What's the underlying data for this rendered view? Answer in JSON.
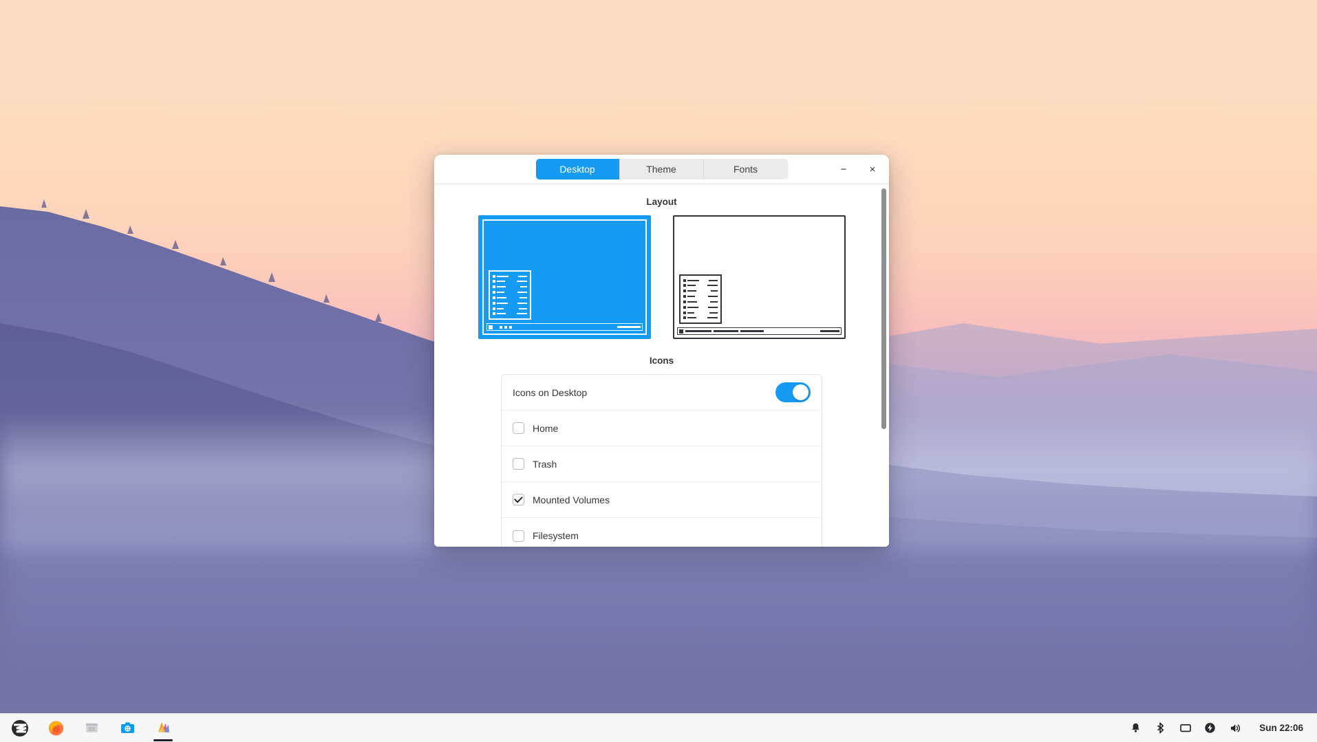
{
  "window": {
    "tabs": [
      {
        "label": "Desktop",
        "active": true
      },
      {
        "label": "Theme",
        "active": false
      },
      {
        "label": "Fonts",
        "active": false
      }
    ],
    "controls": {
      "minimize": "−",
      "close": "×"
    }
  },
  "sections": {
    "layout": {
      "title": "Layout",
      "options": [
        {
          "name": "zorin-menu-layout",
          "selected": true
        },
        {
          "name": "windows-like-layout",
          "selected": false
        }
      ]
    },
    "icons": {
      "title": "Icons",
      "toggle_row": {
        "label": "Icons on Desktop",
        "value": "on"
      },
      "checkboxes": [
        {
          "label": "Home",
          "checked": false
        },
        {
          "label": "Trash",
          "checked": false
        },
        {
          "label": "Mounted Volumes",
          "checked": true
        },
        {
          "label": "Filesystem",
          "checked": false
        }
      ]
    }
  },
  "taskbar": {
    "apps": [
      {
        "name": "zorin-menu-icon",
        "running": false
      },
      {
        "name": "firefox-icon",
        "running": false
      },
      {
        "name": "files-icon",
        "running": false
      },
      {
        "name": "software-icon",
        "running": false
      },
      {
        "name": "appearance-icon",
        "running": true
      }
    ],
    "tray": [
      {
        "name": "notifications-bell-icon"
      },
      {
        "name": "bluetooth-icon"
      },
      {
        "name": "display-icon"
      },
      {
        "name": "power-icon"
      },
      {
        "name": "volume-icon"
      }
    ],
    "clock": "Sun 22:06"
  },
  "colors": {
    "accent": "#159bf3",
    "tab_inactive": "#ebebeb",
    "text": "#33373d",
    "outline_dark": "#31353b"
  }
}
